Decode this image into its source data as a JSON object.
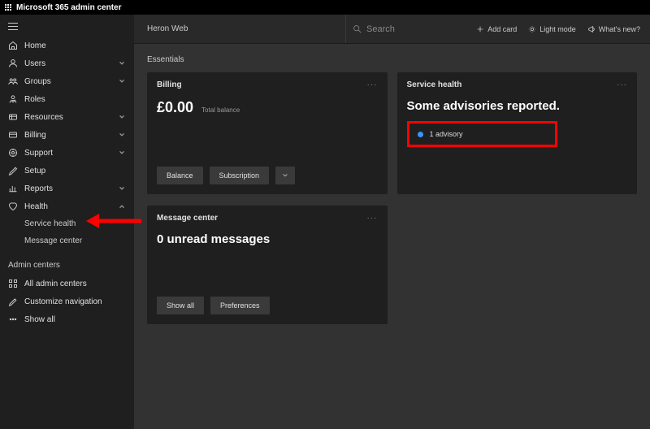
{
  "app": {
    "title": "Microsoft 365 admin center"
  },
  "sidebar": {
    "items": [
      {
        "label": "Home",
        "icon": "home",
        "expand": null
      },
      {
        "label": "Users",
        "icon": "user",
        "expand": "down"
      },
      {
        "label": "Groups",
        "icon": "group",
        "expand": "down"
      },
      {
        "label": "Roles",
        "icon": "roles",
        "expand": null
      },
      {
        "label": "Resources",
        "icon": "resources",
        "expand": "down"
      },
      {
        "label": "Billing",
        "icon": "billing",
        "expand": "down"
      },
      {
        "label": "Support",
        "icon": "support",
        "expand": "down"
      },
      {
        "label": "Setup",
        "icon": "setup",
        "expand": null
      },
      {
        "label": "Reports",
        "icon": "reports",
        "expand": "down"
      },
      {
        "label": "Health",
        "icon": "health",
        "expand": "up"
      }
    ],
    "health_sub": [
      {
        "label": "Service health"
      },
      {
        "label": "Message center"
      }
    ],
    "section_label": "Admin centers",
    "admin_items": [
      {
        "label": "All admin centers",
        "icon": "grid"
      },
      {
        "label": "Customize navigation",
        "icon": "pencil"
      },
      {
        "label": "Show all",
        "icon": "dots"
      }
    ]
  },
  "header": {
    "breadcrumb": "Heron Web",
    "search_placeholder": "Search",
    "actions": {
      "add_card": "Add card",
      "light_mode": "Light mode",
      "whats_new": "What's new?"
    }
  },
  "essentials": {
    "title": "Essentials",
    "billing": {
      "title": "Billing",
      "amount": "£0.00",
      "sub": "Total balance",
      "btn_balance": "Balance",
      "btn_subscription": "Subscription"
    },
    "health": {
      "title": "Service health",
      "headline": "Some advisories reported.",
      "advisory_text": "1 advisory"
    },
    "messages": {
      "title": "Message center",
      "headline": "0 unread messages",
      "btn_show_all": "Show all",
      "btn_preferences": "Preferences"
    }
  }
}
